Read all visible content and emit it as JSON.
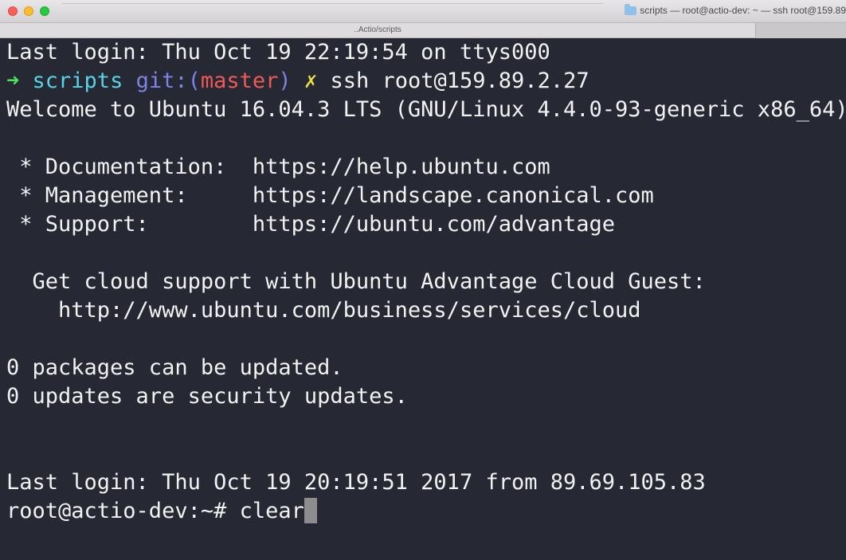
{
  "window": {
    "title": "scripts — root@actio-dev: ~ — ssh root@159.89",
    "subtitle": "..Actio/scripts"
  },
  "colors": {
    "background": "#262833",
    "text": "#f2f2f2",
    "arrow": "#4ce35a",
    "directory": "#58d3e8",
    "git": "#7e83e6",
    "branch": "#ef5a56",
    "dirty_mark": "#e8df45",
    "cursor": "#8d8d8d"
  },
  "terminal": {
    "last_login_local": "Last login: Thu Oct 19 22:19:54 on ttys000",
    "prompt": {
      "arrow": "➜",
      "directory": "scripts",
      "git_prefix": "git:(",
      "branch": "master",
      "git_suffix": ")",
      "dirty_mark": "✗",
      "command": "ssh root@159.89.2.27"
    },
    "welcome": "Welcome to Ubuntu 16.04.3 LTS (GNU/Linux 4.4.0-93-generic x86_64)",
    "doc_line": " * Documentation:  https://help.ubuntu.com",
    "mgmt_line": " * Management:     https://landscape.canonical.com",
    "support_line": " * Support:        https://ubuntu.com/advantage",
    "cloud_line": "  Get cloud support with Ubuntu Advantage Cloud Guest:",
    "cloud_url_line": "    http://www.ubuntu.com/business/services/cloud",
    "packages_line": "0 packages can be updated.",
    "security_line": "0 updates are security updates.",
    "last_login_remote": "Last login: Thu Oct 19 20:19:51 2017 from 89.69.105.83",
    "remote_prompt": "root@actio-dev:~# ",
    "remote_command": "clear"
  }
}
